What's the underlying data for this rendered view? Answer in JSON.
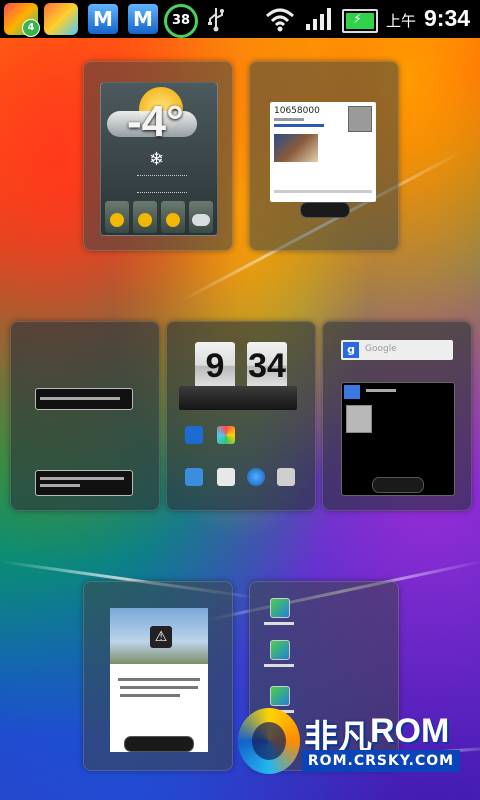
{
  "status_bar": {
    "badge_count": "4",
    "app3_letter": "M",
    "app4_letter": "M",
    "ring_value": "38",
    "ampm": "上午",
    "time": "9:34",
    "icons": [
      "app-icon-1",
      "app-icon-2",
      "shield-m-icon",
      "shield-m-icon",
      "ring-icon",
      "usb-icon",
      "wifi-icon",
      "signal-icon",
      "battery-charging-icon"
    ]
  },
  "weather": {
    "temperature": "-4°"
  },
  "people": {
    "number": "10658000"
  },
  "clock": {
    "hour": "9",
    "minute": "34"
  },
  "search": {
    "placeholder": "Google"
  },
  "logo": {
    "chinese": "非凡",
    "english": "ROM",
    "url": "ROM.CRSKY.COM"
  },
  "colors": {
    "accent_green": "#2fd24a",
    "logo_blue": "#0a44b8"
  }
}
